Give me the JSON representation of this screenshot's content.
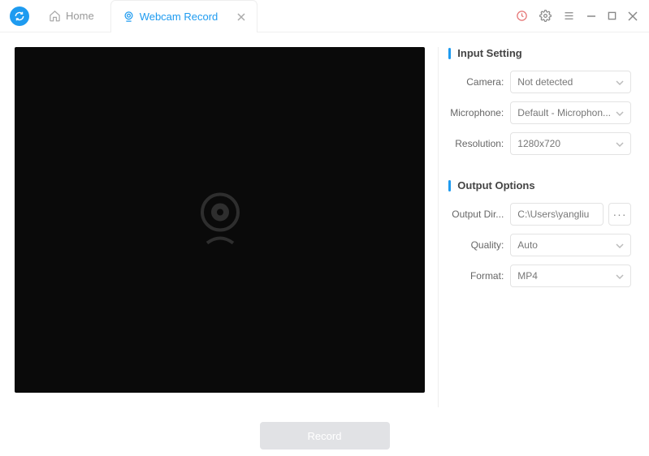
{
  "tabs": {
    "home": "Home",
    "webcam": "Webcam Record"
  },
  "input_setting": {
    "title": "Input Setting",
    "camera_label": "Camera:",
    "camera_value": "Not detected",
    "microphone_label": "Microphone:",
    "microphone_value": "Default - Microphon...",
    "resolution_label": "Resolution:",
    "resolution_value": "1280x720"
  },
  "output_options": {
    "title": "Output Options",
    "output_dir_label": "Output Dir...",
    "output_dir_value": "C:\\Users\\yangliu",
    "quality_label": "Quality:",
    "quality_value": "Auto",
    "format_label": "Format:",
    "format_value": "MP4"
  },
  "record_button": "Record"
}
